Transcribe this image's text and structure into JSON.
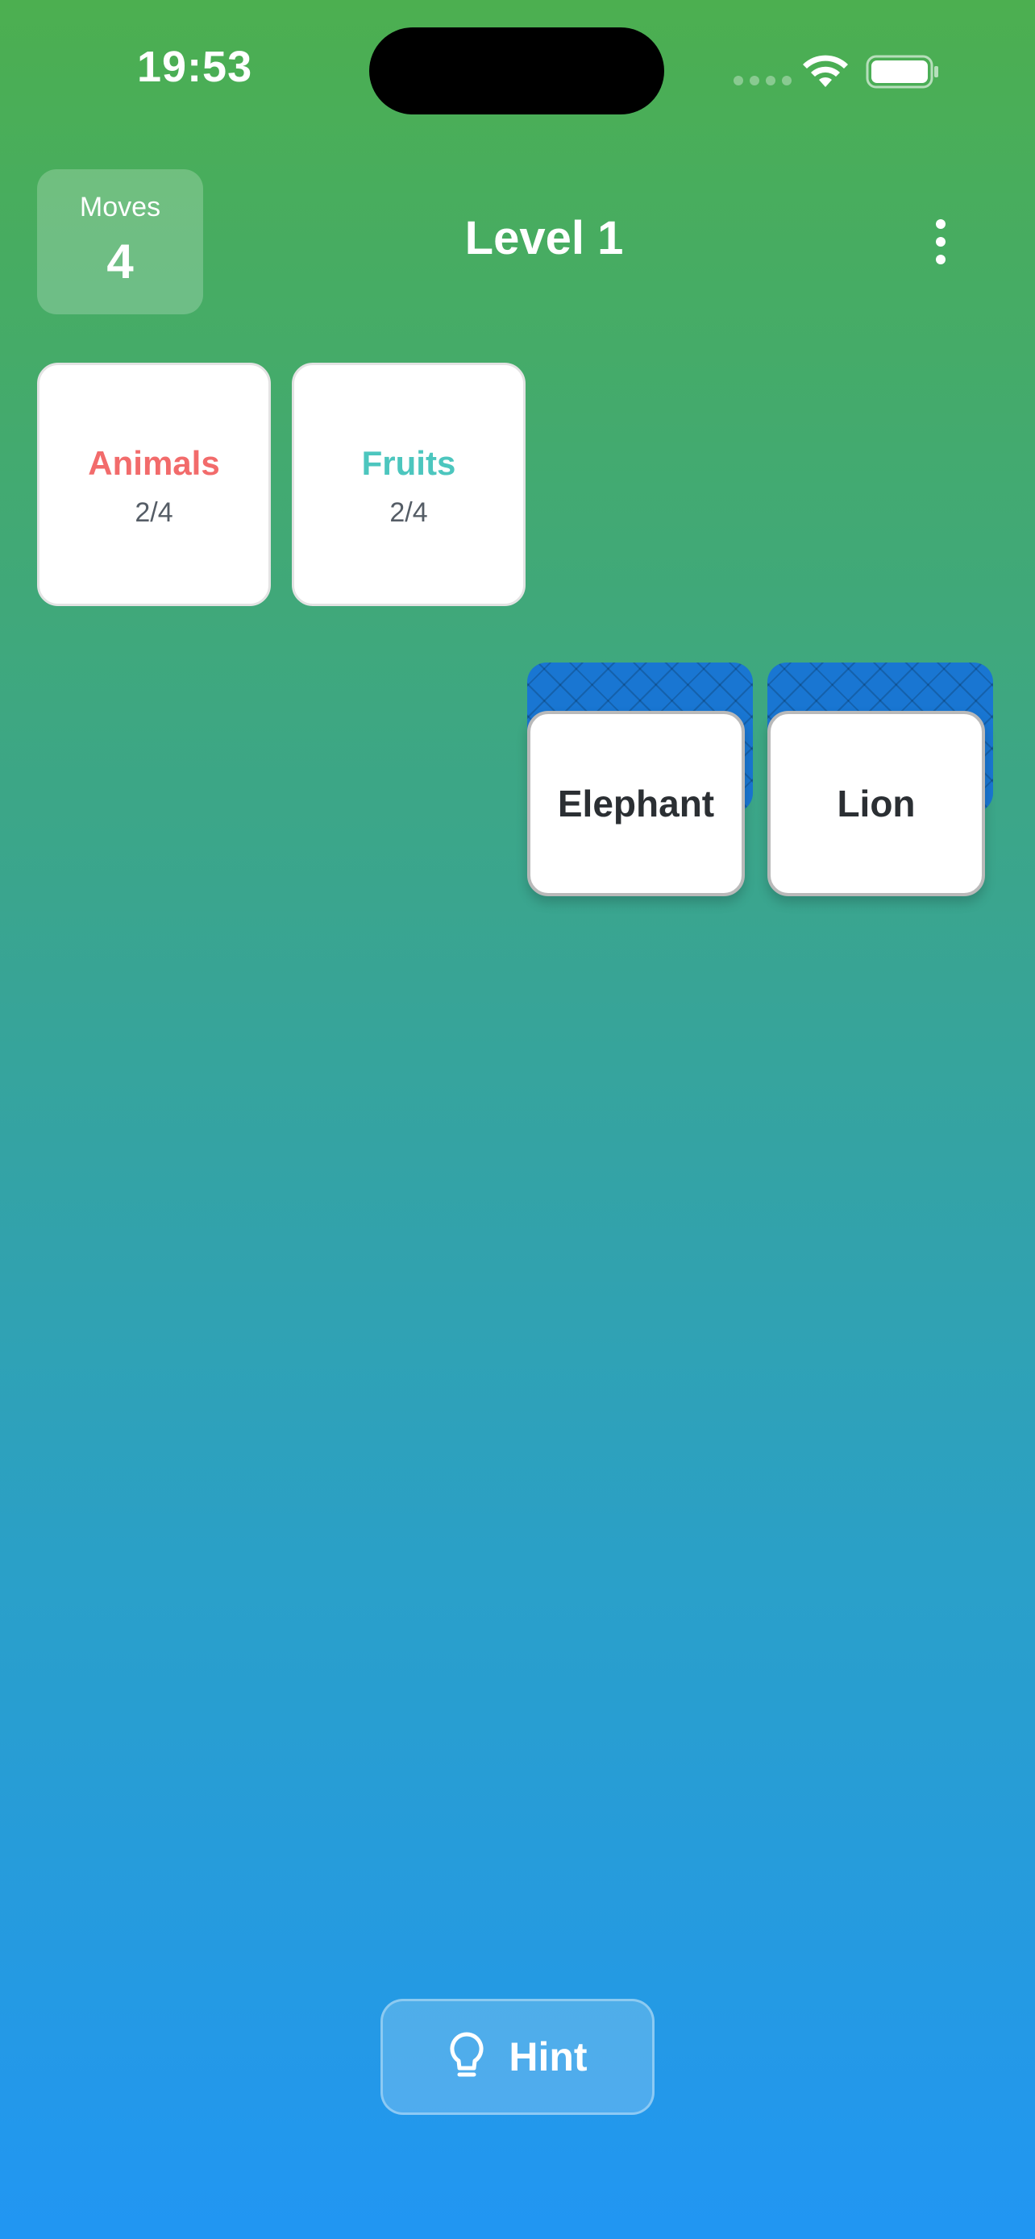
{
  "status_bar": {
    "time": "19:53",
    "icons": [
      "cellular-signal-icon",
      "wifi-icon",
      "battery-icon"
    ]
  },
  "header": {
    "moves_label": "Moves",
    "moves_value": "4",
    "level_title": "Level 1",
    "menu_icon": "more-vertical-icon"
  },
  "categories": [
    {
      "name": "Animals",
      "progress": "2/4",
      "color": "#f26b6b"
    },
    {
      "name": "Fruits",
      "progress": "2/4",
      "color": "#4cc6be"
    }
  ],
  "cards": [
    {
      "word": "Elephant"
    },
    {
      "word": "Lion"
    }
  ],
  "hint": {
    "label": "Hint",
    "icon": "lightbulb-icon"
  },
  "colors": {
    "gradient_top": "#4caf50",
    "gradient_bottom": "#2196f3",
    "card_back": "#1976d2"
  }
}
